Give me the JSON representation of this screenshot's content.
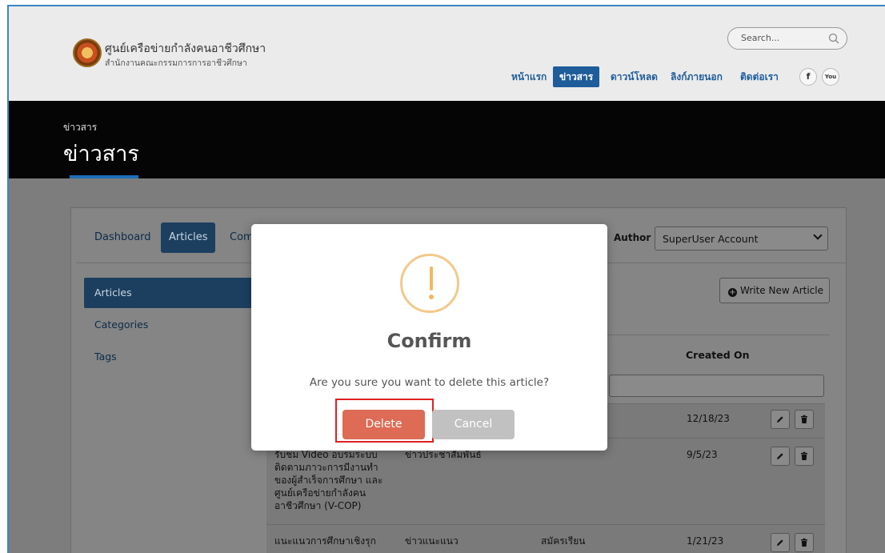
{
  "header": {
    "org_name": "ศูนย์เครือข่ายกำลังคนอาชีวศึกษา",
    "org_subtitle": "สำนักงานคณะกรรมการการอาชีวศึกษา",
    "search_placeholder": "Search...",
    "nav": [
      {
        "label": "หน้าแรก",
        "active": false
      },
      {
        "label": "ข่าวสาร",
        "active": true
      },
      {
        "label": "ดาวน์โหลด",
        "active": false
      },
      {
        "label": "ลิงก์ภายนอก",
        "active": false
      },
      {
        "label": "ติดต่อเรา",
        "active": false
      }
    ],
    "social": [
      {
        "label": "f",
        "icon": "facebook-icon"
      },
      {
        "label": "You",
        "icon": "youtube-icon"
      }
    ]
  },
  "banner": {
    "breadcrumb": "ข่าวสาร",
    "title": "ข่าวสาร"
  },
  "tabs": [
    {
      "label": "Dashboard",
      "active": false
    },
    {
      "label": "Articles",
      "active": true
    },
    {
      "label": "Com",
      "active": false
    }
  ],
  "author": {
    "label": "Author :",
    "selected": "SuperUser Account"
  },
  "sidebar": {
    "items": [
      {
        "label": "Articles",
        "active": true
      },
      {
        "label": "Categories",
        "active": false
      },
      {
        "label": "Tags",
        "active": false
      }
    ]
  },
  "write_button": "Write New Article",
  "table": {
    "created_header": "Created On",
    "rows": [
      {
        "title": "",
        "category": "",
        "status": "",
        "created": "12/18/23"
      },
      {
        "title": "รับชม Video อบรมระบบติดตามภาวะการมีงานทำของผู้สำเร็จการศึกษา และศูนย์เครือข่ายกำลังคนอาชีวศึกษา (V-COP)",
        "category": "ข่าวประชาสัมพันธ์",
        "status": "",
        "created": "9/5/23"
      },
      {
        "title": "แนะแนวการศึกษาเชิงรุก",
        "category": "ข่าวแนะแนว",
        "status": "สมัครเรียน",
        "created": "1/21/23"
      }
    ]
  },
  "modal": {
    "title": "Confirm",
    "message": "Are you sure you want to delete this article?",
    "delete_label": "Delete",
    "cancel_label": "Cancel",
    "colors": {
      "delete": "#dd6b55",
      "cancel": "#c1c1c1",
      "warning": "#f0b860"
    }
  }
}
